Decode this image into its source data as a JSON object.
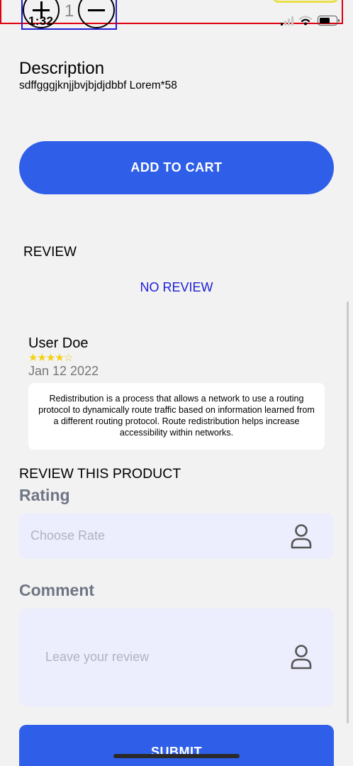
{
  "status_bar": {
    "time": "1:32"
  },
  "quantity": {
    "value": "1"
  },
  "product": {
    "description_title": "Description",
    "description_text": "sdffgggjknjjbvjbjdjdbbf Lorem*58",
    "add_to_cart_label": "ADD TO CART"
  },
  "reviews": {
    "section_title": "REVIEW",
    "empty_label": "NO REVIEW",
    "items": [
      {
        "user": "User Doe",
        "rating": 4,
        "max_rating": 5,
        "date": "Jan 12 2022",
        "text": "Redistribution is a process that allows a network to use a routing protocol to dynamically route traffic based on information learned from a different routing protocol. Route redistribution helps increase accessibility within networks."
      }
    ]
  },
  "review_form": {
    "title": "REVIEW THIS PRODUCT",
    "rating_label": "Rating",
    "rating_placeholder": "Choose Rate",
    "comment_label": "Comment",
    "comment_placeholder": "Leave your review",
    "submit_label": "SUBMIT"
  },
  "colors": {
    "accent": "#2f5fe8",
    "no_review": "#1e1ed8",
    "star": "#f5d00b",
    "field_background": "#ecedfd"
  },
  "icons": {
    "increase": "plus-circle-icon",
    "decrease": "minus-circle-icon",
    "field_icon": "person-icon"
  }
}
